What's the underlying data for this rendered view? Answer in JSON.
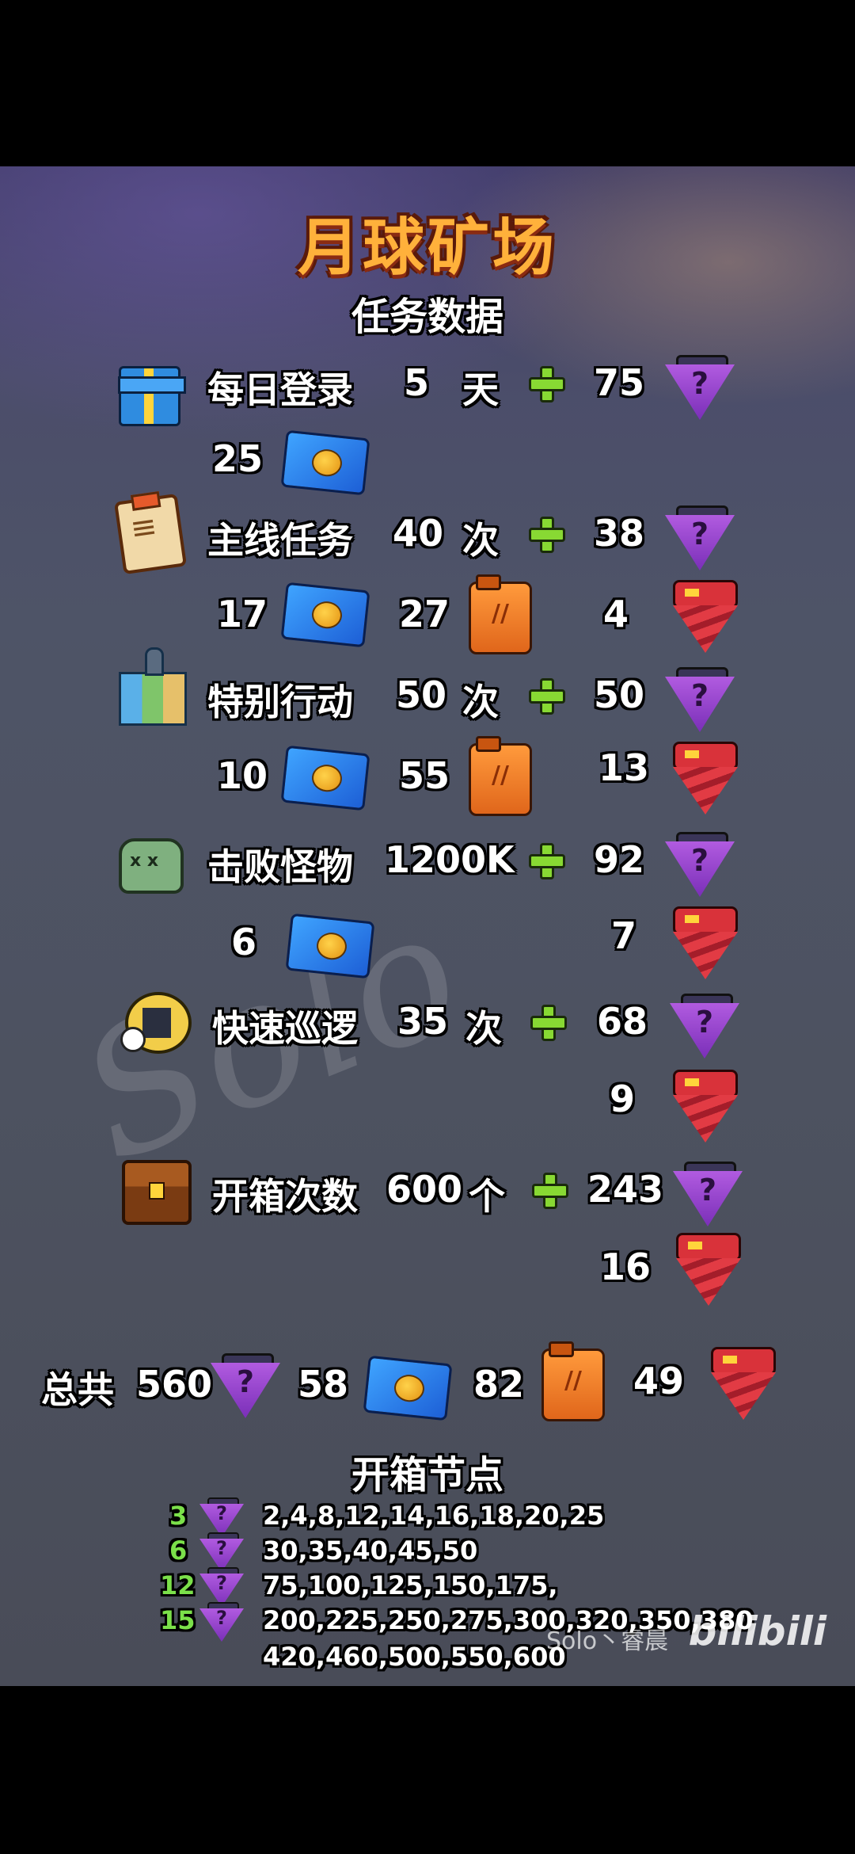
{
  "title": "月球矿场",
  "subtitle": "任务数据",
  "rows": [
    {
      "label": "每日登录",
      "count": "5",
      "unit": "天",
      "gem": "75",
      "ticket": "25",
      "can": "",
      "drill": ""
    },
    {
      "label": "主线任务",
      "count": "40",
      "unit": "次",
      "gem": "38",
      "ticket": "17",
      "can": "27",
      "drill": "4"
    },
    {
      "label": "特别行动",
      "count": "50",
      "unit": "次",
      "gem": "50",
      "ticket": "10",
      "can": "55",
      "drill": "13"
    },
    {
      "label": "击败怪物",
      "count": "1200K",
      "unit": "",
      "gem": "92",
      "ticket": "6",
      "can": "",
      "drill": "7"
    },
    {
      "label": "快速巡逻",
      "count": "35",
      "unit": "次",
      "gem": "68",
      "ticket": "",
      "can": "",
      "drill": "9"
    },
    {
      "label": "开箱次数",
      "count": "600",
      "unit": "个",
      "gem": "243",
      "ticket": "",
      "can": "",
      "drill": "16"
    }
  ],
  "total": {
    "label": "总共",
    "gem": "560",
    "ticket": "58",
    "can": "82",
    "drill": "49"
  },
  "nodes_title": "开箱节点",
  "nodes": [
    {
      "reward": "3",
      "values": "2,4,8,12,14,16,18,20,25"
    },
    {
      "reward": "6",
      "values": "30,35,40,45,50"
    },
    {
      "reward": "12",
      "values": "75,100,125,150,175,"
    },
    {
      "reward": "15",
      "values": "200,225,250,275,300,320,350,380"
    }
  ],
  "nodes_extra": "420,460,500,550,600",
  "watermark": "Solo·睿辰",
  "overlay_user": "Solo丶睿晨",
  "brand": "bilibili"
}
